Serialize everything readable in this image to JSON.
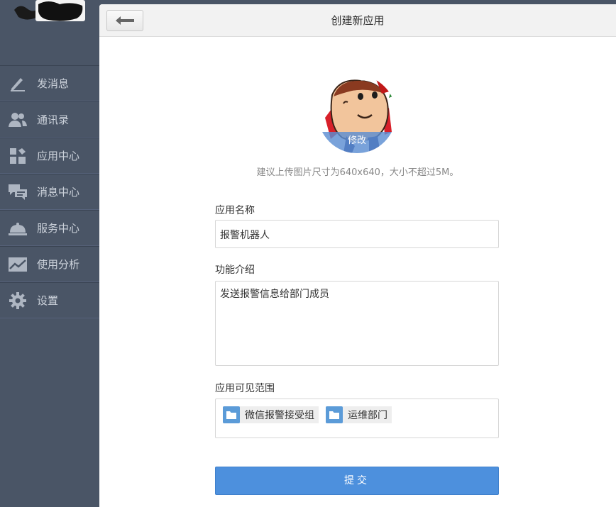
{
  "sidebar": {
    "items": [
      {
        "label": "发消息",
        "icon": "pencil-icon"
      },
      {
        "label": "通讯录",
        "icon": "contacts-icon"
      },
      {
        "label": "应用中心",
        "icon": "apps-icon"
      },
      {
        "label": "消息中心",
        "icon": "chat-bubbles-icon"
      },
      {
        "label": "服务中心",
        "icon": "service-bell-icon"
      },
      {
        "label": "使用分析",
        "icon": "chart-icon"
      },
      {
        "label": "设置",
        "icon": "gear-icon"
      }
    ]
  },
  "header": {
    "title": "创建新应用",
    "back_icon": "arrow-left-icon"
  },
  "avatar": {
    "edit_label": "修改",
    "hint": "建议上传图片尺寸为640x640，大小不超过5M。"
  },
  "form": {
    "name_label": "应用名称",
    "name_value": "报警机器人",
    "desc_label": "功能介绍",
    "desc_value": "发送报警信息给部门成员",
    "scope_label": "应用可见范围",
    "scope_tags": [
      "微信报警接受组",
      "运维部门"
    ],
    "submit_label": "提交"
  },
  "colors": {
    "sidebar_bg": "#4a5566",
    "accent": "#4d90dd",
    "folder": "#5b9bd8"
  }
}
